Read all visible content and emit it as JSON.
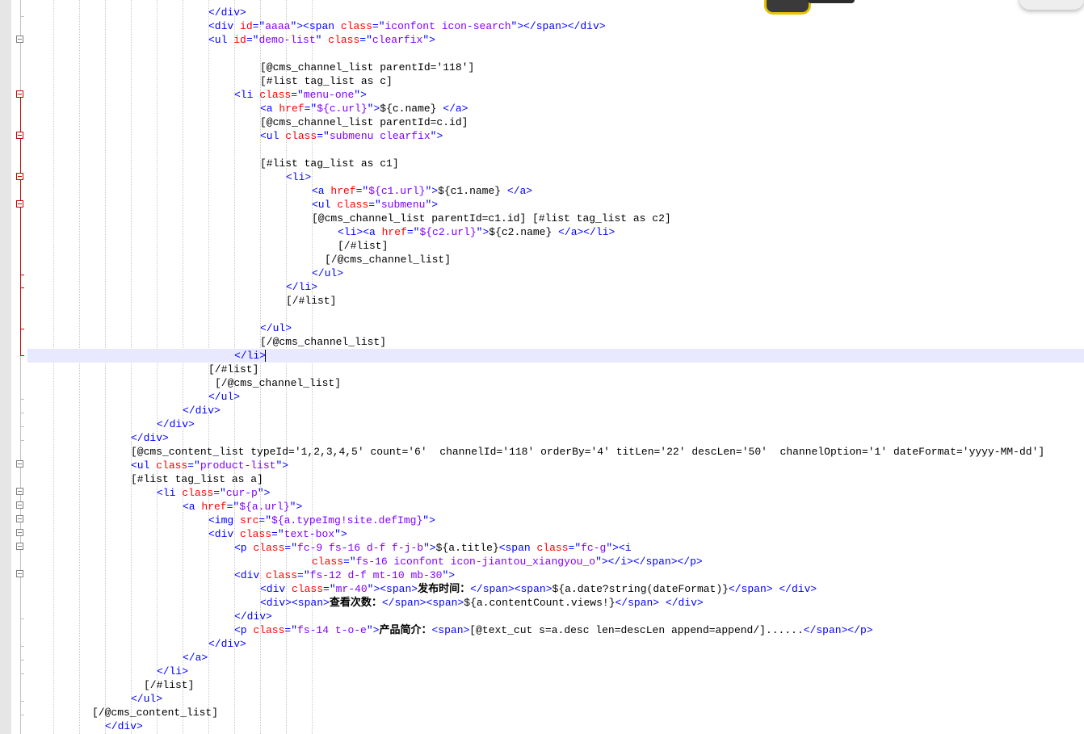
{
  "editor": {
    "lines": [
      [
        {
          "t": "tag",
          "s": "</div>"
        }
      ],
      [
        {
          "t": "tag",
          "s": "<div "
        },
        {
          "t": "attr",
          "s": "id"
        },
        {
          "t": "tag",
          "s": "=\""
        },
        {
          "t": "val",
          "s": "aaaa"
        },
        {
          "t": "tag",
          "s": "\"><span "
        },
        {
          "t": "attr",
          "s": "class"
        },
        {
          "t": "tag",
          "s": "=\""
        },
        {
          "t": "val",
          "s": "iconfont icon-search"
        },
        {
          "t": "tag",
          "s": "\"></span></div>"
        }
      ],
      [
        {
          "t": "tag",
          "s": "<ul "
        },
        {
          "t": "attr",
          "s": "id"
        },
        {
          "t": "tag",
          "s": "=\""
        },
        {
          "t": "val",
          "s": "demo-list"
        },
        {
          "t": "tag",
          "s": "\" "
        },
        {
          "t": "attr",
          "s": "class"
        },
        {
          "t": "tag",
          "s": "=\""
        },
        {
          "t": "val",
          "s": "clearfix"
        },
        {
          "t": "tag",
          "s": "\">"
        }
      ],
      [],
      [
        {
          "t": "text",
          "s": "[@cms_channel_list parentId='118']"
        }
      ],
      [
        {
          "t": "text",
          "s": "[#list tag_list as c]"
        }
      ],
      [
        {
          "t": "tag",
          "s": "<li "
        },
        {
          "t": "attr",
          "s": "class"
        },
        {
          "t": "tag",
          "s": "=\""
        },
        {
          "t": "val",
          "s": "menu-one"
        },
        {
          "t": "tag",
          "s": "\">"
        }
      ],
      [
        {
          "t": "tag",
          "s": "<a "
        },
        {
          "t": "attr",
          "s": "href"
        },
        {
          "t": "tag",
          "s": "=\""
        },
        {
          "t": "val",
          "s": "${c.url}"
        },
        {
          "t": "tag",
          "s": "\">"
        },
        {
          "t": "text",
          "s": "${c.name} "
        },
        {
          "t": "tag",
          "s": "</a>"
        }
      ],
      [
        {
          "t": "text",
          "s": "[@cms_channel_list parentId=c.id]"
        }
      ],
      [
        {
          "t": "tag",
          "s": "<ul "
        },
        {
          "t": "attr",
          "s": "class"
        },
        {
          "t": "tag",
          "s": "=\""
        },
        {
          "t": "val",
          "s": "submenu clearfix"
        },
        {
          "t": "tag",
          "s": "\">"
        }
      ],
      [],
      [
        {
          "t": "text",
          "s": "[#list tag_list as c1]"
        }
      ],
      [
        {
          "t": "tag",
          "s": "<li>"
        }
      ],
      [
        {
          "t": "tag",
          "s": "<a "
        },
        {
          "t": "attr",
          "s": "href"
        },
        {
          "t": "tag",
          "s": "=\""
        },
        {
          "t": "val",
          "s": "${c1.url}"
        },
        {
          "t": "tag",
          "s": "\">"
        },
        {
          "t": "text",
          "s": "${c1.name} "
        },
        {
          "t": "tag",
          "s": "</a>"
        }
      ],
      [
        {
          "t": "tag",
          "s": "<ul "
        },
        {
          "t": "attr",
          "s": "class"
        },
        {
          "t": "tag",
          "s": "=\""
        },
        {
          "t": "val",
          "s": "submenu"
        },
        {
          "t": "tag",
          "s": "\">"
        }
      ],
      [
        {
          "t": "text",
          "s": "[@cms_channel_list parentId=c1.id] [#list tag_list as c2]"
        }
      ],
      [
        {
          "t": "tag",
          "s": "<li><a "
        },
        {
          "t": "attr",
          "s": "href"
        },
        {
          "t": "tag",
          "s": "=\""
        },
        {
          "t": "val",
          "s": "${c2.url}"
        },
        {
          "t": "tag",
          "s": "\">"
        },
        {
          "t": "text",
          "s": "${c2.name} "
        },
        {
          "t": "tag",
          "s": "</a></li>"
        }
      ],
      [
        {
          "t": "text",
          "s": "[/#list]"
        }
      ],
      [
        {
          "t": "text",
          "s": "[/@cms_channel_list]"
        }
      ],
      [
        {
          "t": "tag",
          "s": "</ul>"
        }
      ],
      [
        {
          "t": "tag",
          "s": "</li>"
        }
      ],
      [
        {
          "t": "text",
          "s": "[/#list]"
        }
      ],
      [],
      [
        {
          "t": "tag",
          "s": "</ul>"
        }
      ],
      [
        {
          "t": "text",
          "s": "[/@cms_channel_list]"
        }
      ],
      [
        {
          "t": "tag",
          "s": "</li>"
        }
      ],
      [
        {
          "t": "text",
          "s": "[/#list]"
        }
      ],
      [
        {
          "t": "text",
          "s": "[/@cms_channel_list]"
        }
      ],
      [
        {
          "t": "tag",
          "s": "</ul>"
        }
      ],
      [
        {
          "t": "tag",
          "s": "</div>"
        }
      ],
      [
        {
          "t": "tag",
          "s": "</div>"
        }
      ],
      [
        {
          "t": "tag",
          "s": "</div>"
        }
      ],
      [
        {
          "t": "text",
          "s": "[@cms_content_list typeId='1,2,3,4,5' count='6'  channelId='118' orderBy='4' titLen='22' descLen='50'  channelOption='1' dateFormat='yyyy-MM-dd']"
        }
      ],
      [
        {
          "t": "tag",
          "s": "<ul "
        },
        {
          "t": "attr",
          "s": "class"
        },
        {
          "t": "tag",
          "s": "=\""
        },
        {
          "t": "val",
          "s": "product-list"
        },
        {
          "t": "tag",
          "s": "\">"
        }
      ],
      [
        {
          "t": "text",
          "s": "[#list tag_list as a]"
        }
      ],
      [
        {
          "t": "tag",
          "s": "<li "
        },
        {
          "t": "attr",
          "s": "class"
        },
        {
          "t": "tag",
          "s": "=\""
        },
        {
          "t": "val",
          "s": "cur-p"
        },
        {
          "t": "tag",
          "s": "\">"
        }
      ],
      [
        {
          "t": "tag",
          "s": "<a "
        },
        {
          "t": "attr",
          "s": "href"
        },
        {
          "t": "tag",
          "s": "=\""
        },
        {
          "t": "val",
          "s": "${a.url}"
        },
        {
          "t": "tag",
          "s": "\">"
        }
      ],
      [
        {
          "t": "tag",
          "s": "<img "
        },
        {
          "t": "attr",
          "s": "src"
        },
        {
          "t": "tag",
          "s": "=\""
        },
        {
          "t": "val",
          "s": "${a.typeImg!site.defImg}"
        },
        {
          "t": "tag",
          "s": "\">"
        }
      ],
      [
        {
          "t": "tag",
          "s": "<div "
        },
        {
          "t": "attr",
          "s": "class"
        },
        {
          "t": "tag",
          "s": "=\""
        },
        {
          "t": "val",
          "s": "text-box"
        },
        {
          "t": "tag",
          "s": "\">"
        }
      ],
      [
        {
          "t": "tag",
          "s": "<p "
        },
        {
          "t": "attr",
          "s": "class"
        },
        {
          "t": "tag",
          "s": "=\""
        },
        {
          "t": "val",
          "s": "fc-9 fs-16 d-f f-j-b"
        },
        {
          "t": "tag",
          "s": "\">"
        },
        {
          "t": "text",
          "s": "${a.title}"
        },
        {
          "t": "tag",
          "s": "<span "
        },
        {
          "t": "attr",
          "s": "class"
        },
        {
          "t": "tag",
          "s": "=\""
        },
        {
          "t": "val",
          "s": "fc-g"
        },
        {
          "t": "tag",
          "s": "\"><i"
        }
      ],
      [
        {
          "t": "attr",
          "s": "class"
        },
        {
          "t": "tag",
          "s": "=\""
        },
        {
          "t": "val",
          "s": "fs-16 iconfont icon-jiantou_xiangyou_o"
        },
        {
          "t": "tag",
          "s": "\"></i></span></p>"
        }
      ],
      [
        {
          "t": "tag",
          "s": "<div "
        },
        {
          "t": "attr",
          "s": "class"
        },
        {
          "t": "tag",
          "s": "=\""
        },
        {
          "t": "val",
          "s": "fs-12 d-f mt-10 mb-30"
        },
        {
          "t": "tag",
          "s": "\">"
        }
      ],
      [
        {
          "t": "tag",
          "s": "<div "
        },
        {
          "t": "attr",
          "s": "class"
        },
        {
          "t": "tag",
          "s": "=\""
        },
        {
          "t": "val",
          "s": "mr-40"
        },
        {
          "t": "tag",
          "s": "\"><span>"
        },
        {
          "t": "bold",
          "s": "发布时间："
        },
        {
          "t": "tag",
          "s": "</span><span>"
        },
        {
          "t": "text",
          "s": "${a.date?string(dateFormat)}"
        },
        {
          "t": "tag",
          "s": "</span> </div>"
        }
      ],
      [
        {
          "t": "tag",
          "s": "<div><span>"
        },
        {
          "t": "bold",
          "s": "查看次数："
        },
        {
          "t": "tag",
          "s": "</span><span>"
        },
        {
          "t": "text",
          "s": "${a.contentCount.views!}"
        },
        {
          "t": "tag",
          "s": "</span> </div>"
        }
      ],
      [
        {
          "t": "tag",
          "s": "</div>"
        }
      ],
      [
        {
          "t": "tag",
          "s": "<p "
        },
        {
          "t": "attr",
          "s": "class"
        },
        {
          "t": "tag",
          "s": "=\""
        },
        {
          "t": "val",
          "s": "fs-14 t-o-e"
        },
        {
          "t": "tag",
          "s": "\">"
        },
        {
          "t": "bold",
          "s": "产品简介："
        },
        {
          "t": "tag",
          "s": "<span>"
        },
        {
          "t": "text",
          "s": "[@text_cut s=a.desc len=descLen append=append/]......"
        },
        {
          "t": "tag",
          "s": "</span></p>"
        }
      ],
      [
        {
          "t": "tag",
          "s": "</div>"
        }
      ],
      [
        {
          "t": "tag",
          "s": "</a>"
        }
      ],
      [
        {
          "t": "tag",
          "s": "</li>"
        }
      ],
      [
        {
          "t": "text",
          "s": "[/#list]"
        }
      ],
      [
        {
          "t": "tag",
          "s": "</ul>"
        }
      ],
      [
        {
          "t": "text",
          "s": "[/@cms_content_list]"
        }
      ],
      [
        {
          "t": "tag",
          "s": "</div>"
        }
      ]
    ],
    "colors": {
      "tag": "#0000ff",
      "attribute": "#ff0000",
      "attribute_value": "#8000ff",
      "text": "#000000",
      "current_line_highlight": "#e8e8ff",
      "fold_active": "#cc0000"
    }
  }
}
